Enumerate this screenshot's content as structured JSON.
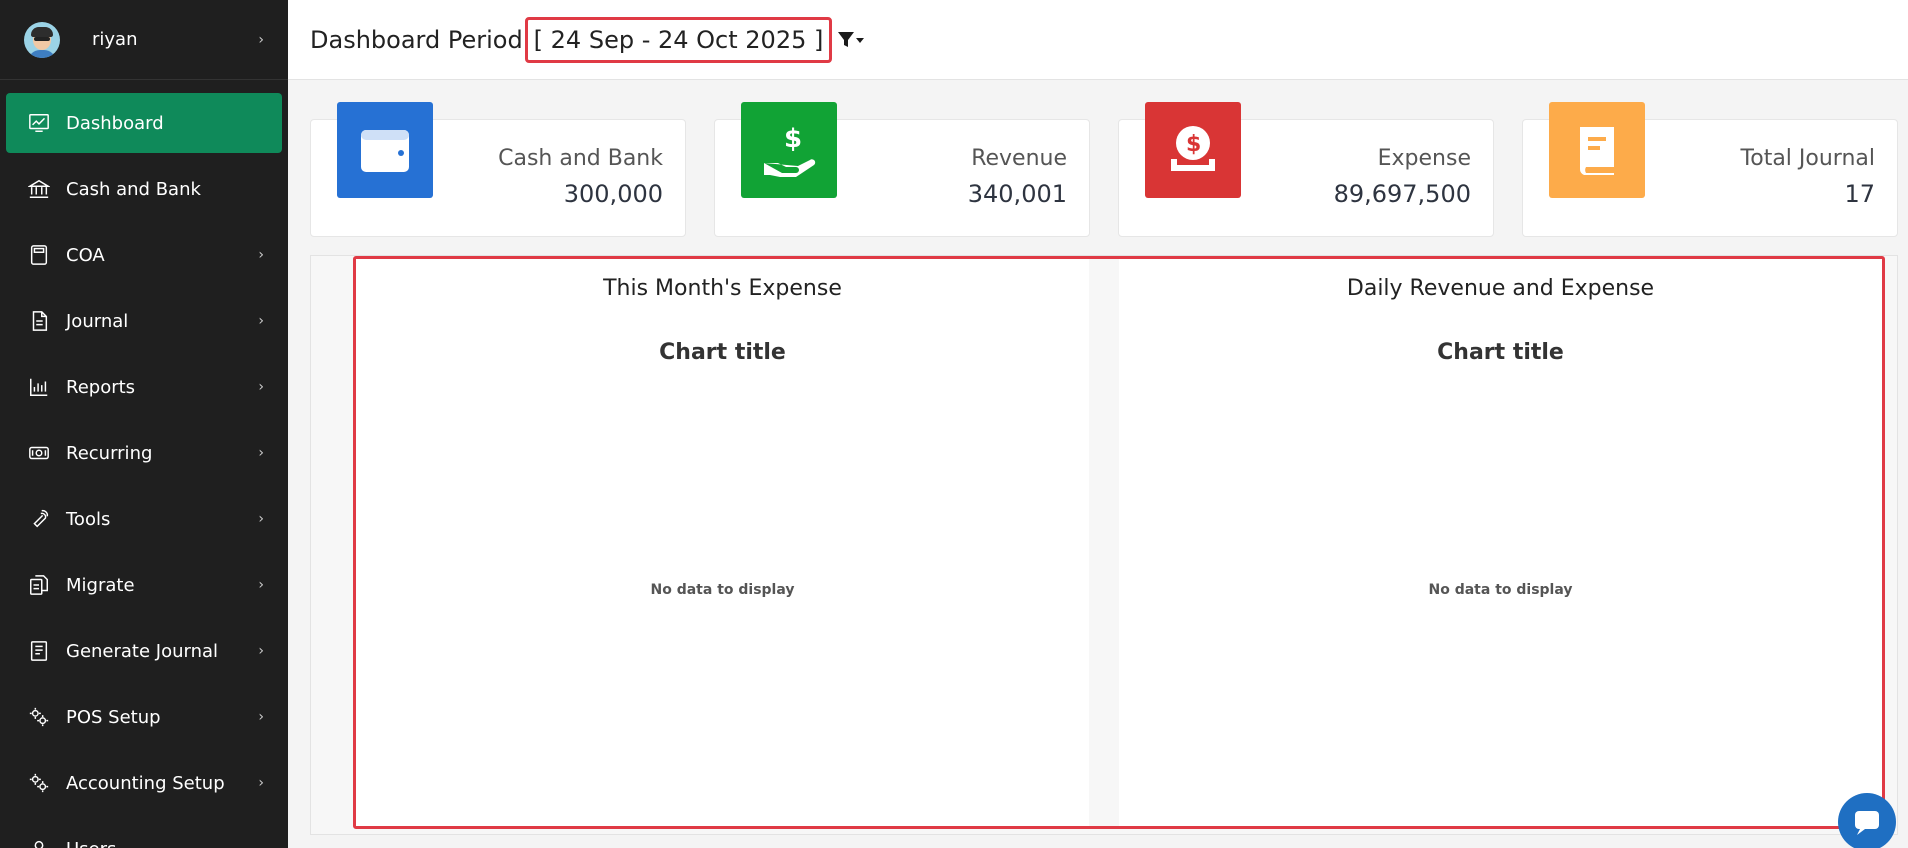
{
  "user": {
    "name": "riyan"
  },
  "sidebar": {
    "items": [
      {
        "label": "Dashboard",
        "icon": "dashboard-chart-icon",
        "active": true,
        "has_submenu": false
      },
      {
        "label": "Cash and Bank",
        "icon": "bank-icon",
        "active": false,
        "has_submenu": false
      },
      {
        "label": "COA",
        "icon": "calculator-icon",
        "active": false,
        "has_submenu": true
      },
      {
        "label": "Journal",
        "icon": "document-icon",
        "active": false,
        "has_submenu": true
      },
      {
        "label": "Reports",
        "icon": "bar-chart-icon",
        "active": false,
        "has_submenu": true
      },
      {
        "label": "Recurring",
        "icon": "money-icon",
        "active": false,
        "has_submenu": true
      },
      {
        "label": "Tools",
        "icon": "wrench-icon",
        "active": false,
        "has_submenu": true
      },
      {
        "label": "Migrate",
        "icon": "migrate-icon",
        "active": false,
        "has_submenu": true
      },
      {
        "label": "Generate Journal",
        "icon": "ledger-icon",
        "active": false,
        "has_submenu": true
      },
      {
        "label": "POS Setup",
        "icon": "gears-icon",
        "active": false,
        "has_submenu": true
      },
      {
        "label": "Accounting Setup",
        "icon": "gears-icon",
        "active": false,
        "has_submenu": true
      },
      {
        "label": "Users",
        "icon": "user-icon",
        "active": false,
        "has_submenu": false
      }
    ]
  },
  "header": {
    "title": "Dashboard Period",
    "period": "[ 24 Sep - 24 Oct 2025 ]"
  },
  "cards": [
    {
      "label": "Cash and Bank",
      "value": "300,000",
      "color": "#2671d4",
      "icon": "wallet-icon"
    },
    {
      "label": "Revenue",
      "value": "340,001",
      "color": "#11a335",
      "icon": "hand-money-icon"
    },
    {
      "label": "Expense",
      "value": "89,697,500",
      "color": "#d93535",
      "icon": "coin-drop-icon"
    },
    {
      "label": "Total Journal",
      "value": "17",
      "color": "#fdab4a",
      "icon": "book-icon"
    }
  ],
  "charts": [
    {
      "header": "This Month's Expense",
      "title": "Chart title",
      "empty": "No data to display"
    },
    {
      "header": "Daily Revenue and Expense",
      "title": "Chart title",
      "empty": "No data to display"
    }
  ],
  "colors": {
    "sidebar_bg": "#1f1f1f",
    "active": "#0f8a5a",
    "highlight": "#e03a45",
    "chat": "#1f6fc2"
  }
}
